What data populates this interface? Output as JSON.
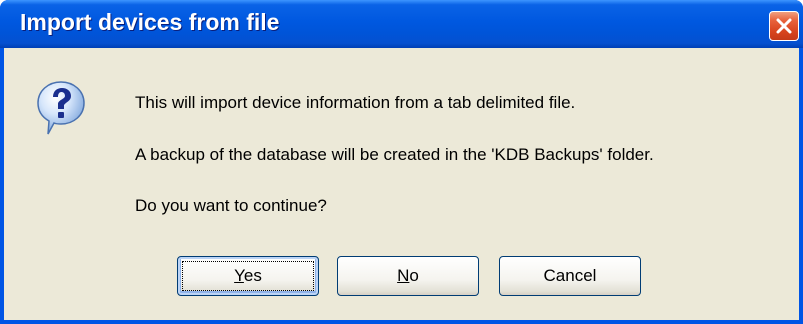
{
  "window": {
    "title": "Import devices from file",
    "close_icon": "close-icon"
  },
  "dialog": {
    "icon": "question-icon",
    "messages": [
      "This will import device information from a tab delimited file.",
      "A backup of the database will be created in the 'KDB Backups' folder.",
      "Do you want to continue?"
    ]
  },
  "buttons": {
    "yes": {
      "accel": "Y",
      "rest": "es",
      "default": true
    },
    "no": {
      "accel": "N",
      "rest": "o"
    },
    "cancel": {
      "label": "Cancel"
    }
  },
  "colors": {
    "titlebar": "#0054d8",
    "client": "#ece9d8",
    "close_button": "#d8441e",
    "button_border": "#003c74"
  }
}
